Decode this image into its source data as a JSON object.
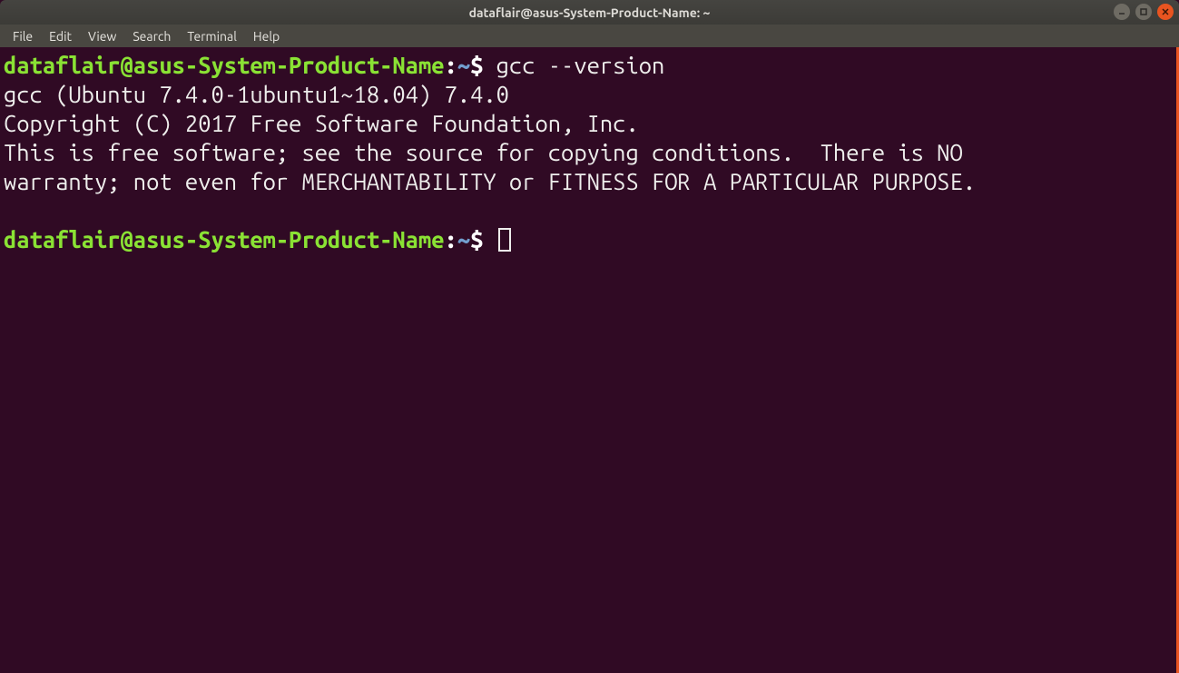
{
  "titlebar": {
    "title": "dataflair@asus-System-Product-Name: ~"
  },
  "menubar": {
    "items": [
      "File",
      "Edit",
      "View",
      "Search",
      "Terminal",
      "Help"
    ]
  },
  "prompt": {
    "user_host": "dataflair@asus-System-Product-Name",
    "sep1": ":",
    "path": "~",
    "sigil": "$ "
  },
  "command": "gcc --version",
  "output": {
    "l1": "gcc (Ubuntu 7.4.0-1ubuntu1~18.04) 7.4.0",
    "l2": "Copyright (C) 2017 Free Software Foundation, Inc.",
    "l3": "This is free software; see the source for copying conditions.  There is NO",
    "l4": "warranty; not even for MERCHANTABILITY or FITNESS FOR A PARTICULAR PURPOSE."
  }
}
